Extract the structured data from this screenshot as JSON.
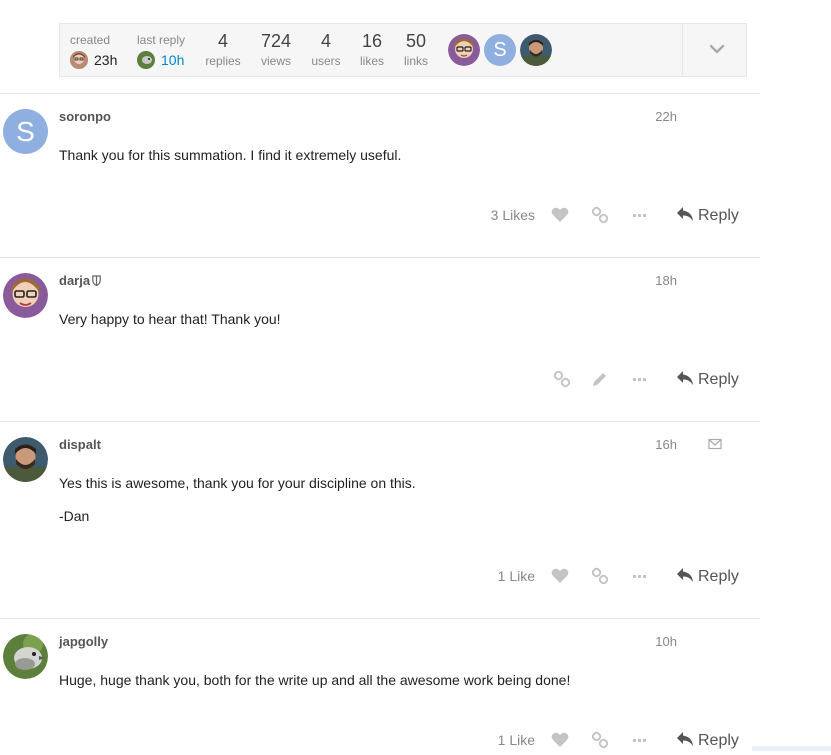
{
  "topic_map": {
    "created_label": "created",
    "created_value": "23h",
    "last_reply_label": "last reply",
    "last_reply_value": "10h",
    "stats": [
      {
        "num": "4",
        "label": "replies"
      },
      {
        "num": "724",
        "label": "views"
      },
      {
        "num": "4",
        "label": "users"
      },
      {
        "num": "16",
        "label": "likes"
      },
      {
        "num": "50",
        "label": "links"
      }
    ],
    "participant_letter": "S"
  },
  "posts": [
    {
      "username": "soronpo",
      "date": "22h",
      "avatar_letter": "S",
      "lines": [
        "Thank you for this summation. I find it extremely useful."
      ],
      "likes": "3 Likes",
      "reply_label": "Reply"
    },
    {
      "username": "darja",
      "date": "18h",
      "lines": [
        "Very happy to hear that! Thank you!"
      ],
      "likes": "",
      "reply_label": "Reply"
    },
    {
      "username": "dispalt",
      "date": "16h",
      "lines": [
        "Yes this is awesome, thank you for your discipline on this.",
        "-Dan"
      ],
      "likes": "1 Like",
      "reply_label": "Reply"
    },
    {
      "username": "japgolly",
      "date": "10h",
      "lines": [
        "Huge, huge thank you, both for the write up and all the awesome work being done!"
      ],
      "likes": "1 Like",
      "reply_label": "Reply"
    }
  ],
  "colors": {
    "accent": "#0088cc",
    "letter_avatar": "#8fafe0",
    "muted": "#888888"
  }
}
